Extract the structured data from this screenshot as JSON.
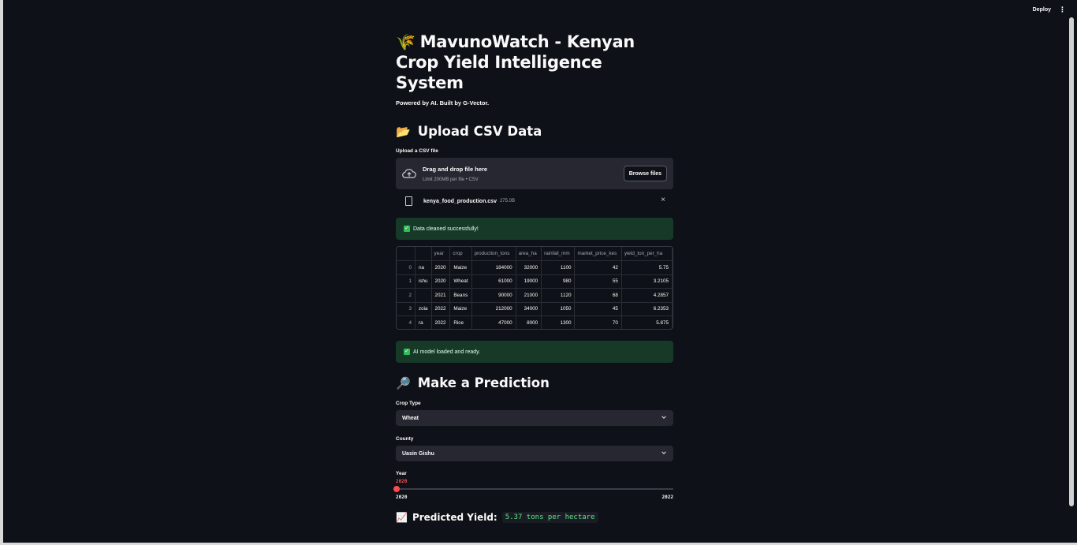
{
  "header": {
    "deploy_label": "Deploy",
    "menu_icon": "⋮"
  },
  "title": {
    "icon": "🌾",
    "text": "MavunoWatch - Kenyan Crop Yield Intelligence System"
  },
  "caption": "Powered by AI. Built by G-Vector.",
  "upload_section": {
    "icon": "📂",
    "heading": "Upload CSV Data",
    "label": "Upload a CSV file",
    "drop_title": "Drag and drop file here",
    "drop_limit": "Limit 200MB per file • CSV",
    "browse_label": "Browse files",
    "file_name": "kenya_food_production.csv",
    "file_size": "275.0B",
    "close_icon": "×"
  },
  "alert_cleaned": "Data cleaned successfully!",
  "table": {
    "columns": [
      "",
      "",
      "year",
      "crop",
      "production_tons",
      "area_ha",
      "rainfall_mm",
      "market_price_kes",
      "yield_ton_per_ha"
    ],
    "rows": [
      [
        "0",
        "na",
        "2020",
        "Maize",
        "184000",
        "32000",
        "1100",
        "42",
        "5.75"
      ],
      [
        "1",
        "ishu",
        "2020",
        "Wheat",
        "61000",
        "19000",
        "980",
        "55",
        "3.2105"
      ],
      [
        "2",
        "",
        "2021",
        "Beans",
        "90000",
        "21000",
        "1120",
        "68",
        "4.2857"
      ],
      [
        "3",
        "zoia",
        "2022",
        "Maize",
        "212000",
        "34000",
        "1050",
        "45",
        "6.2353"
      ],
      [
        "4",
        "ra",
        "2022",
        "Rice",
        "47000",
        "8000",
        "1300",
        "70",
        "5.875"
      ]
    ]
  },
  "alert_model": "AI model loaded and ready.",
  "prediction_section": {
    "icon": "🔎",
    "heading": "Make a Prediction",
    "crop_label": "Crop Type",
    "crop_value": "Wheat",
    "county_label": "County",
    "county_value": "Uasin Gishu",
    "year_label": "Year",
    "year_value": "2020",
    "year_min": "2020",
    "year_max": "2022",
    "year_fraction": 0.0
  },
  "result": {
    "icon": "📈",
    "label": "Predicted Yield:",
    "value": "5.37 tons per hectare"
  },
  "colors": {
    "accent": "#ff4b4b",
    "success_bg": "#173928",
    "widget_bg": "#262730",
    "page_bg": "#0e1117"
  }
}
